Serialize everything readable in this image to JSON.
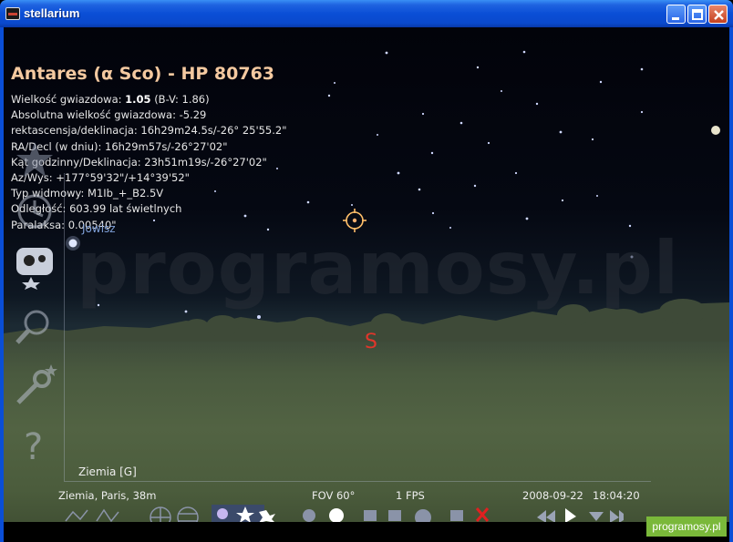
{
  "window": {
    "title": "stellarium"
  },
  "object": {
    "title": "Antares (α Sco) - HP 80763",
    "magnitude_label": "Wielkość gwiazdowa:",
    "magnitude_value": "1.05",
    "magnitude_bv": "(B-V: 1.86)",
    "lines": [
      "Absolutna wielkość gwiazdowa: -5.29",
      "rektascensja/deklinacja: 16h29m24.5s/-26° 25'55.2\"",
      "RA/Decl (w dniu): 16h29m57s/-26°27'02\"",
      "Kąt godzinny/Deklinacja: 23h51m19s/-26°27'02\"",
      "Az/Wys: +177°59'32\"/+14°39'52\"",
      "Typ widmowy: M1Ib_+_B2.5V",
      "Odległość: 603.99 lat świetlnych",
      "Paralaksa: 0.00540\""
    ]
  },
  "sky": {
    "planet_label": "Jowisz",
    "cardinal": "S",
    "location_label": "Ziemia  [G]"
  },
  "watermark": "programosy.pl",
  "status": {
    "location": "Ziemia, Paris, 38m",
    "fov": "FOV 60°",
    "fps": "1 FPS",
    "date": "2008-09-22",
    "time": "18:04:20"
  },
  "badge": "programosy.pl",
  "colors": {
    "accent_title": "#f4c9a0",
    "cardinal": "#e0362b",
    "planet_label": "#7fa0d8",
    "badge": "#7ab83a"
  },
  "icons": {
    "left_bar": [
      "clock-icon",
      "sky-view-icon",
      "search-icon",
      "settings-wrench-icon",
      "help-icon"
    ],
    "bottom_bar": [
      "constellation-icon",
      "grid-icon",
      "ground-icon",
      "star-icon",
      "nebula-icon",
      "planet-icon",
      "close-icon",
      "time-control-icon"
    ]
  }
}
